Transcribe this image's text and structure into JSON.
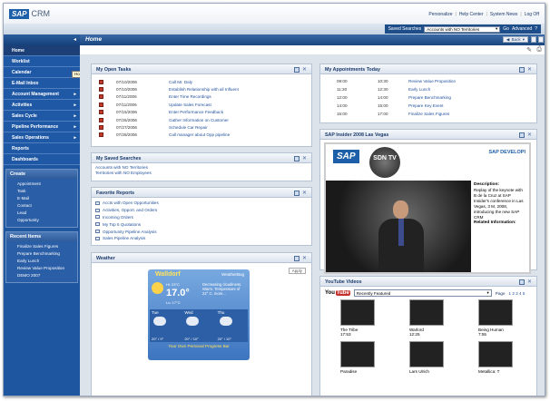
{
  "app": {
    "brand": "SAP",
    "product": "CRM"
  },
  "toplinks": [
    "Personalize",
    "Help Center",
    "System News",
    "Log Off"
  ],
  "saved_search": {
    "label": "Saved Searches",
    "value": "Accounts with NO Territories",
    "go": "Go",
    "advanced": "Advanced"
  },
  "nav": {
    "items": [
      "Home",
      "Worklist",
      "Calendar",
      "E-Mail Inbox",
      "Account Management",
      "Activities",
      "Sales Cycle",
      "Pipeline Performance",
      "Sales Operations",
      "Reports",
      "Dashboards"
    ],
    "tooltip": "Home"
  },
  "create": {
    "title": "Create",
    "items": [
      "Appointment",
      "Task",
      "E-Mail",
      "Contact",
      "Lead",
      "Opportunity"
    ]
  },
  "recent": {
    "title": "Recent Items",
    "items": [
      "Finalize Sales Figures",
      "Prepare Benchmarking",
      "Early Lunch",
      "Review Value Proposition",
      "DEMO 2007"
    ]
  },
  "page": {
    "title": "Home",
    "back": "Back"
  },
  "tasks": {
    "title": "My Open Tasks",
    "rows": [
      {
        "date": "07/10/2006",
        "text": "Call Mr. Daly"
      },
      {
        "date": "07/10/2006",
        "text": "Establish Relationship with all Influent"
      },
      {
        "date": "07/11/2006",
        "text": "Enter Time Recordings"
      },
      {
        "date": "07/11/2006",
        "text": "Update Sales Forecast"
      },
      {
        "date": "07/15/2006",
        "text": "Enter Performance Feedback"
      },
      {
        "date": "07/26/2006",
        "text": "Gather Information on Customer"
      },
      {
        "date": "07/27/2006",
        "text": "Schedule Car Repair"
      },
      {
        "date": "07/28/2006",
        "text": "Call manager about Opp pipeline"
      }
    ]
  },
  "appointments": {
    "title": "My Appointments Today",
    "rows": [
      {
        "start": "09:00",
        "end": "10:30",
        "text": "Review Value Proposition"
      },
      {
        "start": "11:30",
        "end": "12:30",
        "text": "Early Lunch"
      },
      {
        "start": "12:00",
        "end": "14:00",
        "text": "Prepare Benchmarking"
      },
      {
        "start": "14:00",
        "end": "15:00",
        "text": "Prepare Key Event"
      },
      {
        "start": "15:00",
        "end": "17:00",
        "text": "Finalize Sales Figures"
      }
    ]
  },
  "saved": {
    "title": "My Saved Searches",
    "items": [
      "Accounts with NO Territories",
      "Territories with NO Employees"
    ]
  },
  "reports": {
    "title": "Favorite Reports",
    "items": [
      "Accts with Open Opportunities",
      "Activities, Opport. and Orders",
      "Incoming Orders",
      "My Top 5 Quotations",
      "Opportunity Pipeline Analysis",
      "Sales Pipeline Analysis"
    ]
  },
  "weather": {
    "title": "Weather",
    "city": "Walldorf",
    "unit": "DE",
    "brand": "WeatherBug",
    "temp": "17.0°",
    "hi": "Hi: 23°C",
    "lo": "Lo: 17°C",
    "desc": "Decreasing cloudiness. Warm. Temperature of 22° C. more...",
    "days": [
      {
        "name": "Tue",
        "t": "20° / 9°"
      },
      {
        "name": "Wed",
        "t": "20° / 10°"
      },
      {
        "name": "Thu",
        "t": "20° / 10°"
      }
    ],
    "footer": "Your Own Personal Progress Bar",
    "btn": "Apply"
  },
  "insider": {
    "title": "SAP Insider 2008 Las Vegas",
    "desc_title": "Description:",
    "desc": "Replay of the keynote with B de la Cruz at SAP Insider's conference in Las Vegas, 3 M, 2008, introducing the new SAP CRM",
    "related": "Related Information:",
    "develop": "SAP DEVELOPI",
    "sdn": "SDN TV",
    "sap": "SAP"
  },
  "youtube": {
    "title": "YouTube Videos",
    "select": "Recently Featured",
    "page_label": "Page",
    "pages": "1 2 3 4 5",
    "videos": [
      {
        "title": "The Tribe",
        "dur": "17:53"
      },
      {
        "title": "Warlord",
        "dur": "12:25"
      },
      {
        "title": "Being Human",
        "dur": "7:55"
      },
      {
        "title": "Paradise",
        "dur": ""
      },
      {
        "title": "Lars Ulrich",
        "dur": ""
      },
      {
        "title": "Metallica: T",
        "dur": ""
      }
    ]
  }
}
